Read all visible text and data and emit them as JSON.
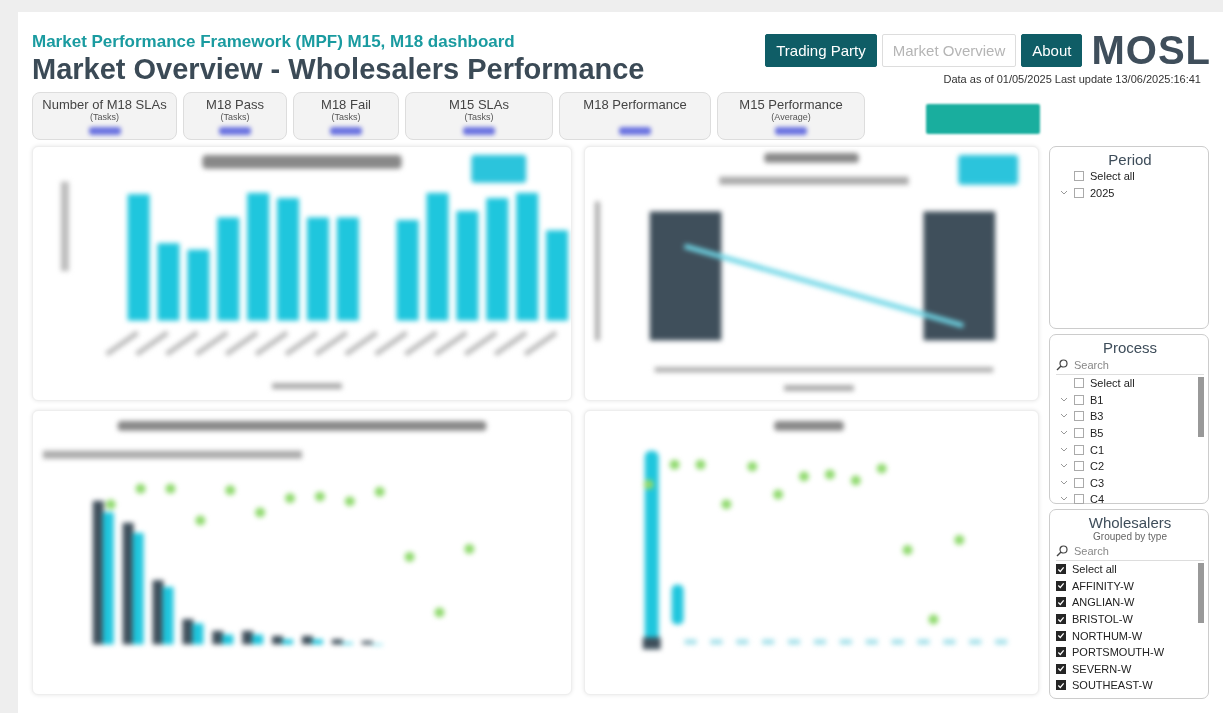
{
  "header": {
    "subtitle": "Market Performance Framework (MPF) M15, M18 dashboard",
    "title": "Market Overview - Wholesalers Performance"
  },
  "nav": [
    {
      "label": "Trading Party",
      "selected": false
    },
    {
      "label": "Market Overview",
      "selected": true
    },
    {
      "label": "About",
      "selected": false
    }
  ],
  "logo": {
    "text": "MOSL"
  },
  "data_note": "Data as of 01/05/2025  Last update 13/06/2025:16:41",
  "kpis": [
    {
      "label": "Number of M18 SLAs",
      "sub": "(Tasks)"
    },
    {
      "label": "M18 Pass",
      "sub": "(Tasks)"
    },
    {
      "label": "M18 Fail",
      "sub": "(Tasks)"
    },
    {
      "label": "M15 SLAs",
      "sub": "(Tasks)"
    },
    {
      "label": "M18 Performance"
    },
    {
      "label": "M15 Performance",
      "sub": "(Average)"
    }
  ],
  "charts": [
    {
      "kind": "bars"
    },
    {
      "kind": "combo"
    },
    {
      "kind": "grouped"
    },
    {
      "kind": "scatter"
    }
  ],
  "slicers": [
    {
      "title": "Period",
      "items": [
        {
          "label": "Select all",
          "checked": false,
          "expandable": false
        },
        {
          "label": "2025",
          "checked": false,
          "expandable": true
        }
      ]
    },
    {
      "title": "Process",
      "search": {
        "placeholder": "Search"
      },
      "items": [
        {
          "label": "Select all",
          "checked": false,
          "expandable": false
        },
        {
          "label": "B1",
          "checked": false,
          "expandable": true
        },
        {
          "label": "B3",
          "checked": false,
          "expandable": true
        },
        {
          "label": "B5",
          "checked": false,
          "expandable": true
        },
        {
          "label": "C1",
          "checked": false,
          "expandable": true
        },
        {
          "label": "C2",
          "checked": false,
          "expandable": true
        },
        {
          "label": "C3",
          "checked": false,
          "expandable": true
        },
        {
          "label": "C4",
          "checked": false,
          "expandable": true
        }
      ]
    },
    {
      "title": "Wholesalers",
      "subtitle": "Grouped by type",
      "search": {
        "placeholder": "Search"
      },
      "items": [
        {
          "label": "Select all",
          "checked": true,
          "expandable": false
        },
        {
          "label": "AFFINITY-W",
          "checked": true,
          "expandable": false
        },
        {
          "label": "ANGLIAN-W",
          "checked": true,
          "expandable": false
        },
        {
          "label": "BRISTOL-W",
          "checked": true,
          "expandable": false
        },
        {
          "label": "NORTHUM-W",
          "checked": true,
          "expandable": false
        },
        {
          "label": "PORTSMOUTH-W",
          "checked": true,
          "expandable": false
        },
        {
          "label": "SEVERN-W",
          "checked": true,
          "expandable": false
        },
        {
          "label": "SOUTHEAST-W",
          "checked": true,
          "expandable": false
        }
      ]
    }
  ]
}
